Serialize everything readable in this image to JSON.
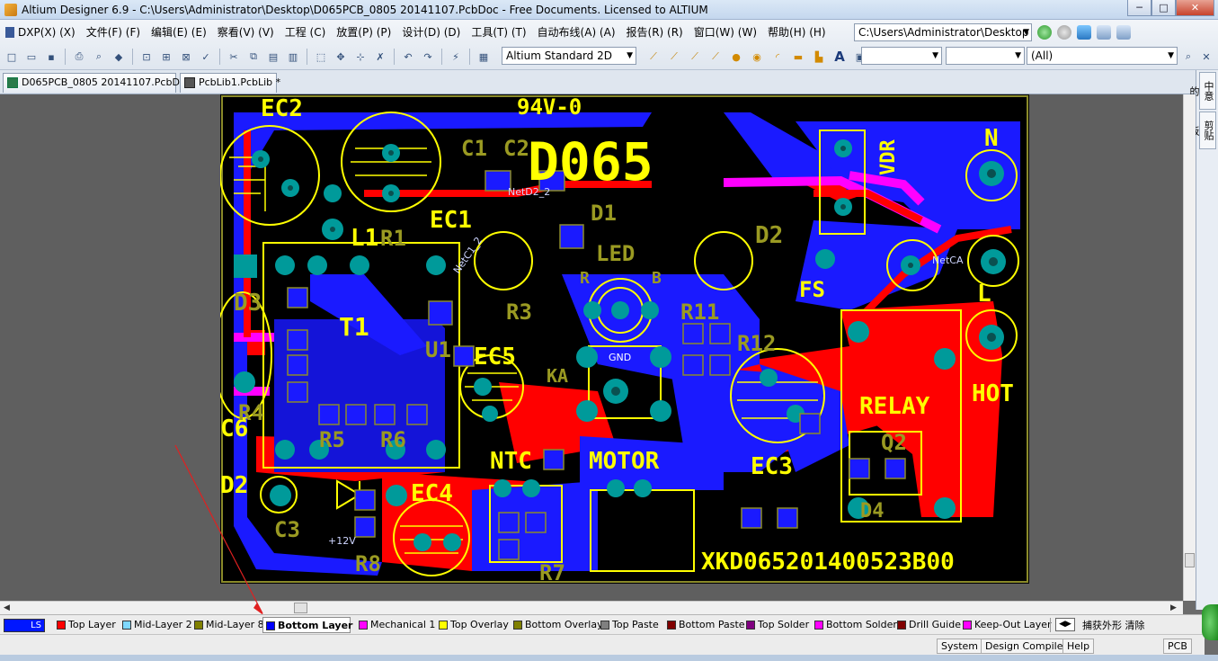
{
  "window": {
    "title": "Altium Designer 6.9 - C:\\Users\\Administrator\\Desktop\\D065PCB_0805 20141107.PcbDoc - Free Documents. Licensed to ALTIUM",
    "min": "─",
    "max": "□",
    "close": "✕"
  },
  "menu": [
    "DXP(X) (X)",
    "文件(F) (F)",
    "编辑(E) (E)",
    "察看(V) (V)",
    "工程 (C)",
    "放置(P) (P)",
    "设计(D) (D)",
    "工具(T) (T)",
    "自动布线(A) (A)",
    "报告(R) (R)",
    "窗口(W) (W)",
    "帮助(H) (H)"
  ],
  "path_combo": "C:\\Users\\Administrator\\Desktop",
  "view_combo": "Altium Standard 2D",
  "filter_combo": "(All)",
  "documents": [
    {
      "label": "D065PCB_0805 20141107.PcbDoc"
    },
    {
      "label": "PcbLib1.PcbLib *"
    }
  ],
  "side_tabs": [
    "中意的",
    "剪贴板"
  ],
  "pcb": {
    "labels": {
      "ec2": "EC2",
      "v94": "94V-0",
      "c1": "C1",
      "c2": "C2",
      "d065": "D065",
      "vdr": "VDR",
      "n": "N",
      "ec1": "EC1",
      "l1": "L1",
      "r1": "R1",
      "d1": "D1",
      "d2b": "D2",
      "led": "LED",
      "fs": "FS",
      "l": "L",
      "d3": "D3",
      "t1": "T1",
      "r3": "R3",
      "r11": "R11",
      "r12": "R12",
      "u1": "U1",
      "ec5": "EC5",
      "gnd": "GND",
      "relay": "RELAY",
      "hot": "HOT",
      "c6": "C6",
      "r4": "R4",
      "r5": "R5",
      "r6": "R6",
      "ntc": "NTC",
      "motor": "MOTOR",
      "ec3": "EC3",
      "q2": "Q2",
      "d2": "D2",
      "ec4": "EC4",
      "c3": "C3",
      "r8": "R8",
      "r7": "R7",
      "d4": "D4",
      "serial": "XKD065201400523B00",
      "netc1_2": "NetC1_2",
      "netca": "NetCA",
      "netd2": "NetD2_2",
      "plus12": "+12V",
      "ka": "KA",
      "b": "B",
      "r": "R"
    }
  },
  "layers": {
    "ls": "LS",
    "items": [
      {
        "name": "Top Layer",
        "color": "#ff0000"
      },
      {
        "name": "Mid-Layer 2",
        "color": "#7fd8ff"
      },
      {
        "name": "Mid-Layer 8",
        "color": "#808000"
      },
      {
        "name": "Bottom Layer",
        "color": "#0000ff"
      },
      {
        "name": "Mechanical 1",
        "color": "#ff00ff"
      },
      {
        "name": "Top Overlay",
        "color": "#ffff00"
      },
      {
        "name": "Bottom Overlay",
        "color": "#808000"
      },
      {
        "name": "Top Paste",
        "color": "#808080"
      },
      {
        "name": "Bottom Paste",
        "color": "#800000"
      },
      {
        "name": "Top Solder",
        "color": "#800080"
      },
      {
        "name": "Bottom Solder",
        "color": "#ff00ff"
      },
      {
        "name": "Drill Guide",
        "color": "#800000"
      },
      {
        "name": "Keep-Out Layer",
        "color": "#ff00ff"
      }
    ],
    "right_text": "捕获外形 清除"
  },
  "status": {
    "system": "System",
    "design_compiler": "Design Compiler",
    "help": "Help",
    "pcb": "PCB"
  }
}
